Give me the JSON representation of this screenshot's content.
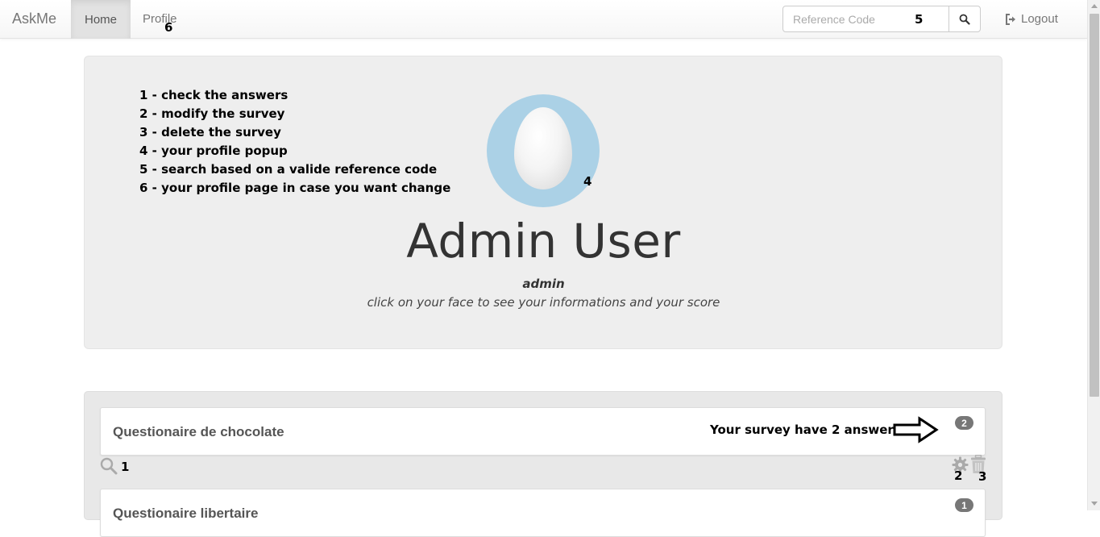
{
  "navbar": {
    "brand": "AskMe",
    "home_label": "Home",
    "profile_label": "Profile",
    "search": {
      "placeholder": "Reference Code"
    },
    "logout_label": "Logout"
  },
  "annotations": {
    "profile_num": "6",
    "search_num": "5",
    "avatar_num": "4",
    "check_num": "1",
    "modify_num": "2",
    "delete_num": "3"
  },
  "legend": [
    "1 - check the answers",
    "2 - modify the survey",
    "3 - delete the survey",
    "4 - your profile popup",
    "5 - search based on a valide reference code",
    "6 - your profile page in case you want change"
  ],
  "profile": {
    "full_name": "Admin User",
    "username": "admin",
    "hint": "click on your face to see your informations and your score"
  },
  "surveys": [
    {
      "title": "Questionaire de chocolate",
      "answers_count": "2"
    },
    {
      "title": "Questionaire libertaire",
      "answers_count": "1"
    }
  ],
  "answers_note": "Your survey have 2 answers",
  "icons": {
    "search": "search-icon",
    "logout": "logout-icon",
    "magnifier": "magnifier-icon",
    "gear": "gear-icon",
    "trash": "trash-icon",
    "arrow": "arrow-right-icon"
  },
  "colors": {
    "jumbotron_bg": "#eeeeee",
    "avatar_bg": "#abd1e6",
    "badge_bg": "#777777",
    "nav_active_bg": "#e2e2e2"
  }
}
